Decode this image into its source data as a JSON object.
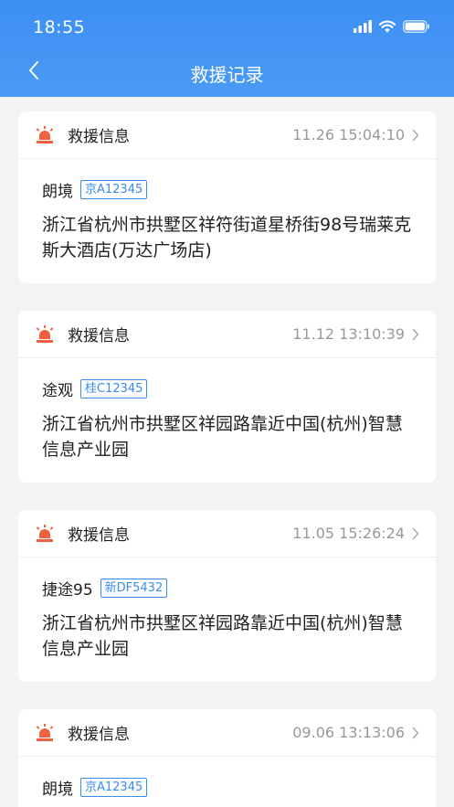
{
  "status_bar": {
    "time": "18:55"
  },
  "nav": {
    "title": "救援记录"
  },
  "records": [
    {
      "label": "救援信息",
      "time": "11.26 15:04:10",
      "car_model": "朗境",
      "plate": "京A12345",
      "address": "浙江省杭州市拱墅区祥符街道星桥街98号瑞莱克斯大酒店(万达广场店)"
    },
    {
      "label": "救援信息",
      "time": "11.12 13:10:39",
      "car_model": "途观",
      "plate": "桂C12345",
      "address": "浙江省杭州市拱墅区祥园路靠近中国(杭州)智慧信息产业园"
    },
    {
      "label": "救援信息",
      "time": "11.05 15:26:24",
      "car_model": "捷途95",
      "plate": "新DF5432",
      "address": "浙江省杭州市拱墅区祥园路靠近中国(杭州)智慧信息产业园"
    },
    {
      "label": "救援信息",
      "time": "09.06 13:13:06",
      "car_model": "朗境",
      "plate": "京A12345",
      "address": ""
    }
  ],
  "colors": {
    "header": "#3d8ff3",
    "accent": "#3a8bf0",
    "alarm": "#f2613f"
  },
  "icons": {
    "back": "chevron-left-icon",
    "alarm": "alarm-light-icon",
    "arrow": "chevron-right-icon"
  }
}
